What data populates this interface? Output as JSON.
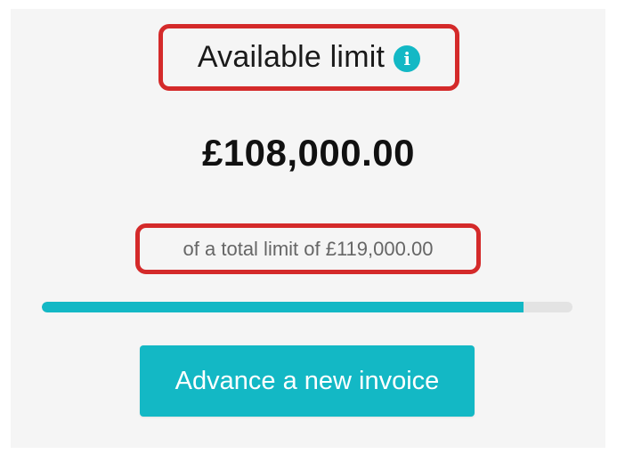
{
  "limit_panel": {
    "title": "Available limit",
    "info_icon": "info-icon",
    "info_glyph": "i",
    "available_amount": "£108,000.00",
    "total_text": "of a total limit of £119,000.00",
    "progress_fraction": 0.908,
    "advance_button_label": "Advance a new invoice"
  },
  "colors": {
    "accent": "#13b8c5",
    "highlight_border": "#d42a2a",
    "track": "#e3e3e3",
    "panel_background": "#f5f5f5"
  }
}
